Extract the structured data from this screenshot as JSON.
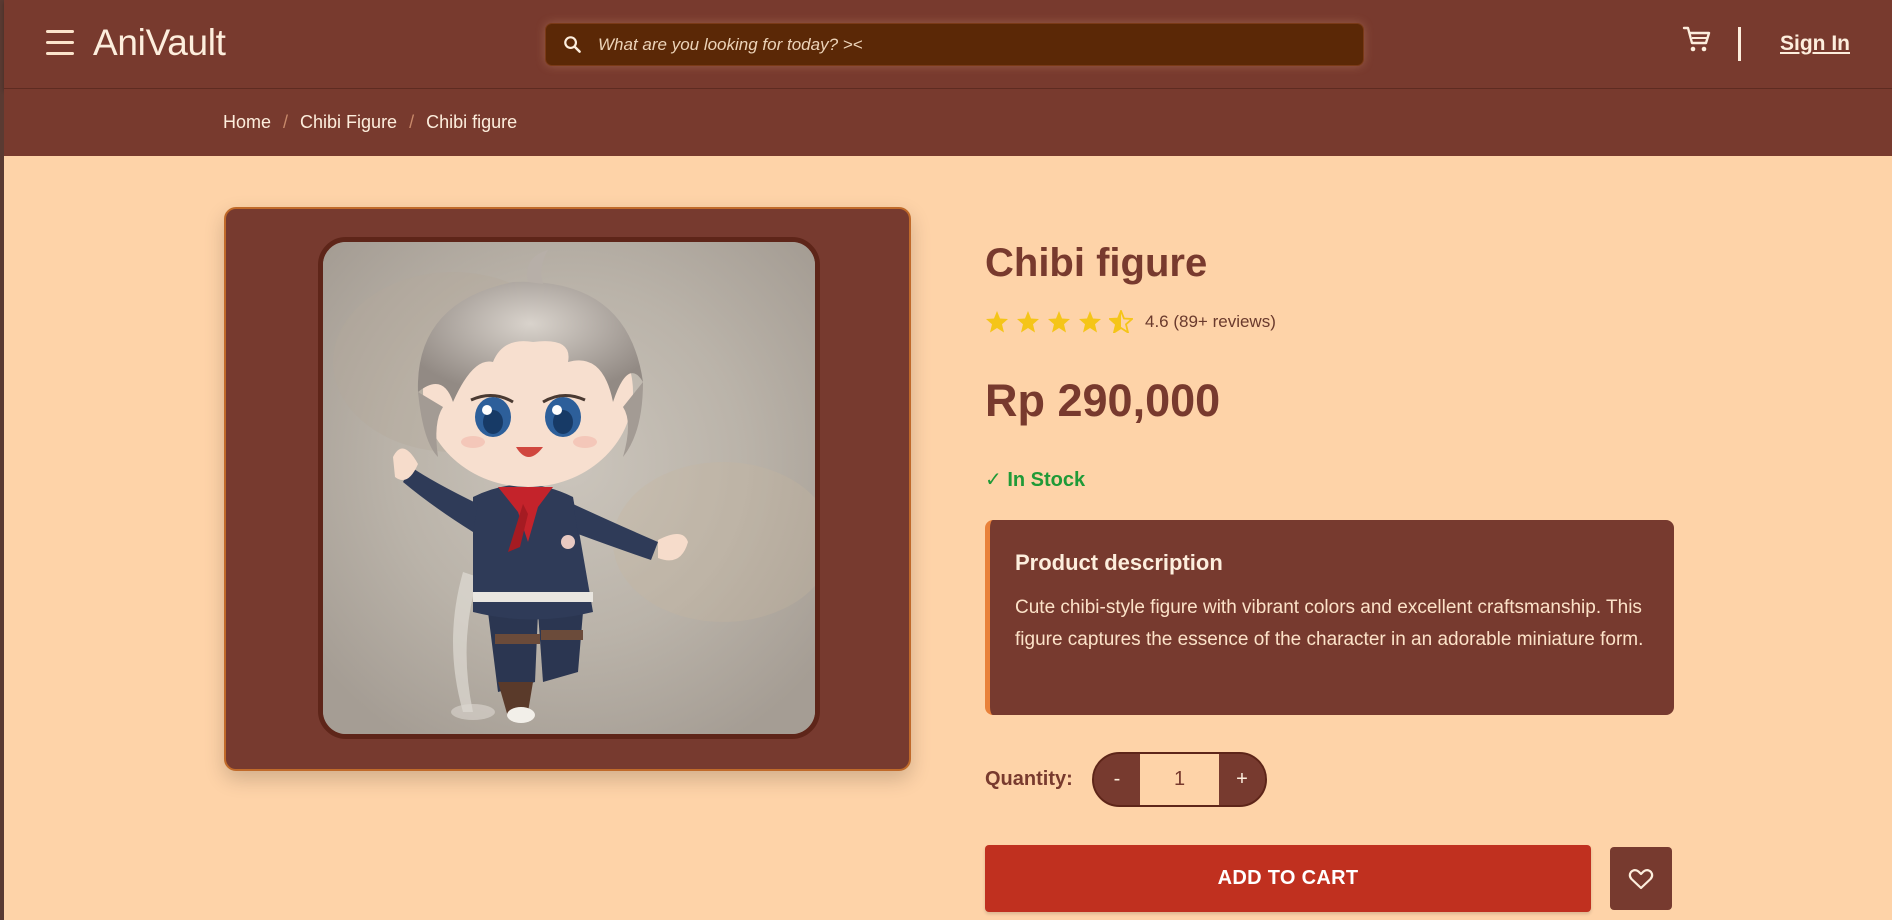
{
  "header": {
    "logo": "AniVault",
    "search_placeholder": "What are you looking for today? ><",
    "signin_label": "Sign In"
  },
  "breadcrumb": [
    "Home",
    "Chibi Figure",
    "Chibi figure"
  ],
  "product": {
    "title": "Chibi figure",
    "rating": 4.6,
    "rating_text": "4.6 (89+ reviews)",
    "price": "Rp 290,000",
    "stock": "✓ In Stock",
    "description_title": "Product description",
    "description": "Cute chibi-style figure with vibrant colors and excellent craftsmanship. This figure captures the essence of the character in an adorable miniature form.",
    "quantity_label": "Quantity:",
    "quantity": "1",
    "minus": "-",
    "plus": "+",
    "add_to_cart": "ADD TO CART"
  },
  "colors": {
    "header_bg": "#783a2e",
    "page_bg": "#fed3a8",
    "accent_red": "#c0301f",
    "in_stock": "#1f9a37",
    "star": "#f5c518"
  },
  "icons": {
    "menu": "hamburger-icon",
    "search": "search-icon",
    "cart": "cart-icon",
    "wishlist": "heart-icon",
    "star": "star-icon"
  }
}
